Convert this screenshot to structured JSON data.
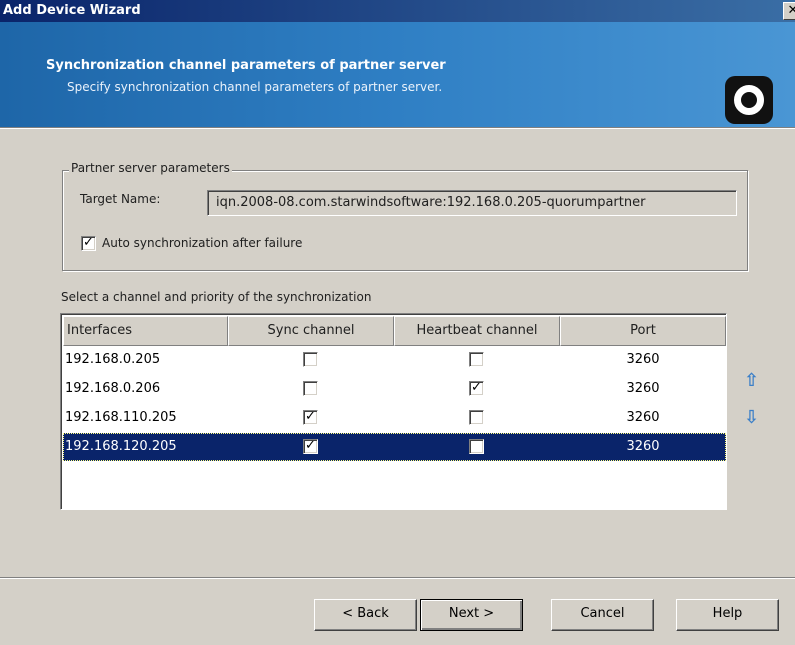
{
  "window": {
    "title": "Add Device Wizard",
    "close_label": "✕"
  },
  "header": {
    "title": "Synchronization channel parameters of partner server",
    "subtitle": "Specify synchronization channel parameters of partner server.",
    "logo_icon": "starwind-logo-icon"
  },
  "partner": {
    "group_label": "Partner server parameters",
    "target_name_label": "Target Name:",
    "target_name_value": "iqn.2008-08.com.starwindsoftware:192.168.0.205-quorumpartner",
    "auto_sync_label": "Auto synchronization after failure",
    "auto_sync_checked": true
  },
  "channels": {
    "label": "Select a channel and priority of the synchronization",
    "columns": [
      "Interfaces",
      "Sync channel",
      "Heartbeat channel",
      "Port"
    ],
    "rows": [
      {
        "interface": "192.168.0.205",
        "sync": false,
        "heartbeat": false,
        "port": "3260",
        "selected": false
      },
      {
        "interface": "192.168.0.206",
        "sync": false,
        "heartbeat": true,
        "port": "3260",
        "selected": false
      },
      {
        "interface": "192.168.110.205",
        "sync": true,
        "heartbeat": false,
        "port": "3260",
        "selected": false
      },
      {
        "interface": "192.168.120.205",
        "sync": true,
        "heartbeat": false,
        "port": "3260",
        "selected": true
      }
    ],
    "move_up_icon": "arrow-up-icon",
    "move_down_icon": "arrow-down-icon"
  },
  "buttons": {
    "back": "< Back",
    "next": "Next >",
    "cancel": "Cancel",
    "help": "Help"
  },
  "colors": {
    "selection": "#0a246a",
    "banner": "#2f7fc4",
    "arrow": "#3b7fc8"
  }
}
